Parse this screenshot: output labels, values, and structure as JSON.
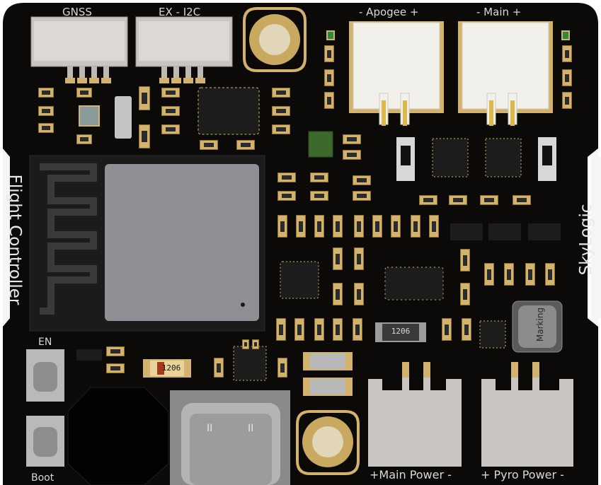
{
  "board": {
    "colors": {
      "pcb": "#0b0a08",
      "silkscreen": "#e6e6e6",
      "pad": "#d2b26c",
      "connector_white": "#f2f0ea",
      "connector_gray": "#c9c6c1",
      "module_shield": "#8f8f95"
    },
    "labels": {
      "gnss": "GNSS",
      "ex_i2c": "EX - I2C",
      "apogee": "- Apogee +",
      "main": "- Main +",
      "flight_controller": "Flight Controller",
      "skylogic": "SkyLogic",
      "en": "EN",
      "boot": "Boot",
      "main_power": "+Main Power -",
      "pyro_power": "+ Pyro Power -",
      "marking": "Marking",
      "resistor_1206_a": "1206",
      "resistor_1206_b": "1206"
    }
  }
}
